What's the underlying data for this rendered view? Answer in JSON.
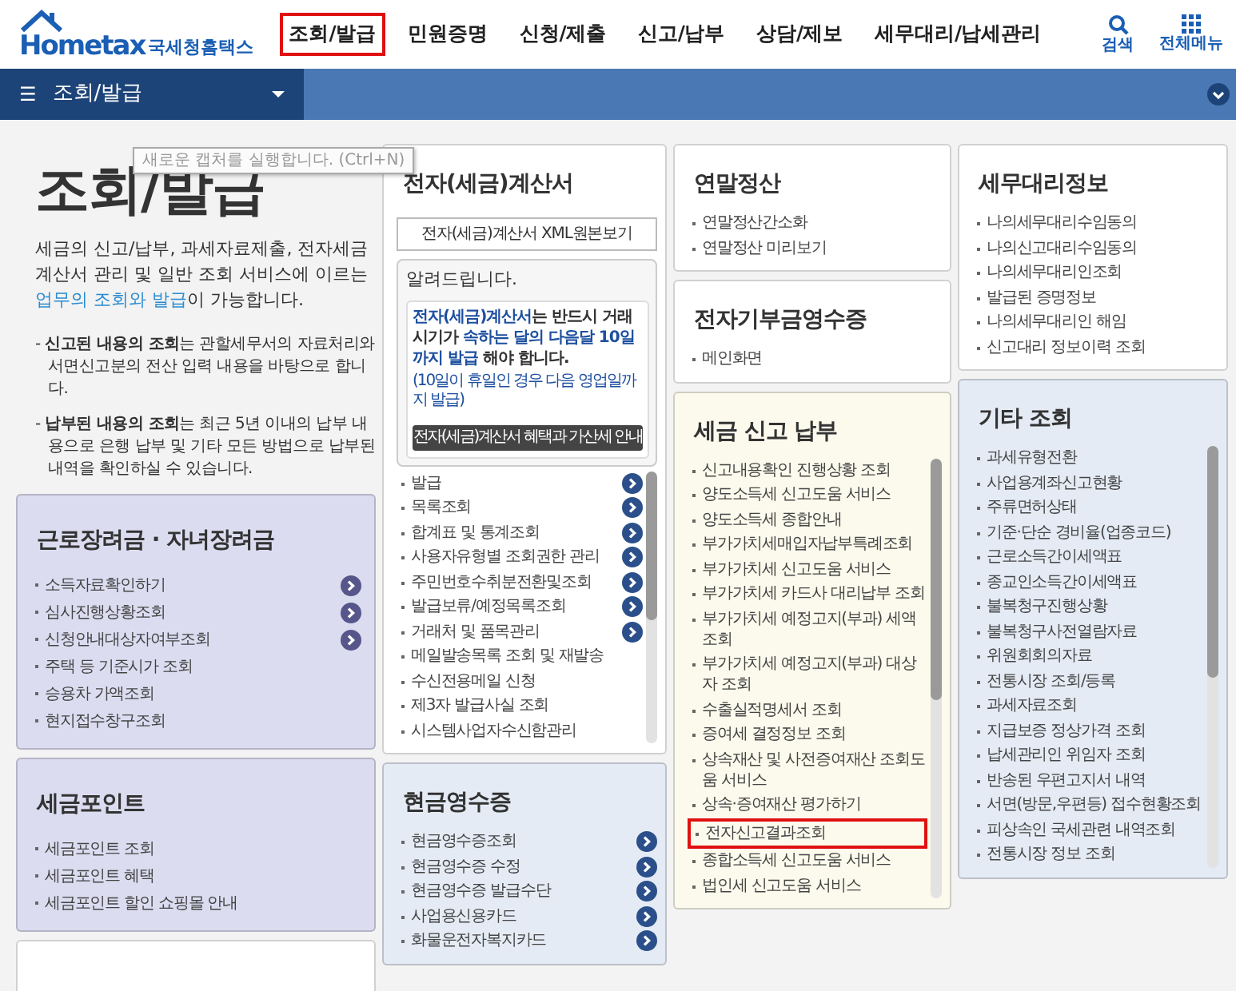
{
  "header": {
    "logo": {
      "brand": "Hometax",
      "subtitle": "국세청홈택스"
    },
    "nav": [
      {
        "label": "조회/발급",
        "highlighted": true
      },
      {
        "label": "민원증명",
        "highlighted": false
      },
      {
        "label": "신청/제출",
        "highlighted": false
      },
      {
        "label": "신고/납부",
        "highlighted": false
      },
      {
        "label": "상담/제보",
        "highlighted": false
      },
      {
        "label": "세무대리/납세관리",
        "highlighted": false
      }
    ],
    "tools": [
      {
        "kind": "search",
        "label": "검색"
      },
      {
        "kind": "menu",
        "label": "전체메뉴"
      }
    ]
  },
  "menu_bar": {
    "icon": "☰",
    "label": "조회/발급"
  },
  "tooltip": "새로운 캡처를 실행합니다. (Ctrl+N)",
  "intro": {
    "title": "조회/발급",
    "description": [
      {
        "text": "세금의 신고/납부, 과세자료제출, 전자세금계산서 관리 및 일반 조회 서비스에 이르는 ",
        "emphasis": false
      },
      {
        "text": "업무의 조회와 발급",
        "emphasis": true
      },
      {
        "text": "이 가능합니다.",
        "emphasis": false
      }
    ],
    "notes": [
      "- **신고된 내용의 조회**는 관할세무서의 자료처리와 서면신고분의 전산 입력 내용을 바탕으로 합니다.",
      "- **납부된 내용의 조회**는 최근 5년 이내의 납부 내용으로 은행 납부 및 기타 모든 방법으로 납부된 내역을 확인하실 수 있습니다."
    ]
  },
  "columns": [
    {
      "cards": [
        {
          "title": "근로장려금 · 자녀장려금",
          "color": "#dcdcf1",
          "items": [
            {
              "label": "소득자료확인하기",
              "arrow": true,
              "highlighted": false
            },
            {
              "label": "심사진행상황조회",
              "arrow": true,
              "highlighted": false
            },
            {
              "label": "신청안내대상자여부조회",
              "arrow": true,
              "highlighted": false
            },
            {
              "label": "주택 등 기준시가 조회",
              "arrow": false,
              "highlighted": false
            },
            {
              "label": "승용차 가액조회",
              "arrow": false,
              "highlighted": false
            },
            {
              "label": "현지접수창구조회",
              "arrow": false,
              "highlighted": false
            }
          ]
        },
        {
          "title": "세금포인트",
          "color": "#dcdcf1",
          "items": [
            {
              "label": "세금포인트 조회",
              "arrow": false,
              "highlighted": false
            },
            {
              "label": "세금포인트 혜택",
              "arrow": false,
              "highlighted": false
            },
            {
              "label": "세금포인트 할인 쇼핑몰 안내",
              "arrow": false,
              "highlighted": false
            }
          ]
        },
        {
          "color": "#ffffff"
        }
      ]
    },
    {
      "cards": [
        {
          "title": "전자(세금)계산서",
          "color": "#ffffff",
          "scrollable": true,
          "button": "전자(세금)계산서 XML원본보기",
          "notice": {
            "title": "알려드립니다.",
            "text": [
              {
                "text": "전자(세금)계산서",
                "emphasis": true
              },
              {
                "text": "는 반드시 거래시기가 ",
                "emphasis": false
              },
              {
                "text": "속하는 달의 다음달 10일까지 발급",
                "emphasis": true
              },
              {
                "text": " 해야 합니다.",
                "emphasis": false
              }
            ],
            "note": "(10일이 휴일인 경우 다음 영업일까지 발급)",
            "button": "전자(세금)계산서 혜택과 가산세 안내"
          },
          "items": [
            {
              "label": "발급",
              "arrow": true,
              "highlighted": false
            },
            {
              "label": "목록조회",
              "arrow": true,
              "highlighted": false
            },
            {
              "label": "합계표 및 통계조회",
              "arrow": true,
              "highlighted": false
            },
            {
              "label": "사용자유형별 조회권한 관리",
              "arrow": true,
              "highlighted": false
            },
            {
              "label": "주민번호수취분전환및조회",
              "arrow": true,
              "highlighted": false
            },
            {
              "label": "발급보류/예정목록조회",
              "arrow": true,
              "highlighted": false
            },
            {
              "label": "거래처 및 품목관리",
              "arrow": true,
              "highlighted": false
            },
            {
              "label": "메일발송목록 조회 및 재발송",
              "arrow": false,
              "highlighted": false
            },
            {
              "label": "수신전용메일 신청",
              "arrow": false,
              "highlighted": false
            },
            {
              "label": "제3자 발급사실 조회",
              "arrow": false,
              "highlighted": false
            },
            {
              "label": "시스템사업자수신함관리",
              "arrow": false,
              "highlighted": false
            }
          ]
        },
        {
          "title": "현금영수증",
          "color": "#e4ebf5",
          "items": [
            {
              "label": "현금영수증조회",
              "arrow": true,
              "highlighted": false
            },
            {
              "label": "현금영수증 수정",
              "arrow": true,
              "highlighted": false
            },
            {
              "label": "현금영수증 발급수단",
              "arrow": true,
              "highlighted": false
            },
            {
              "label": "사업용신용카드",
              "arrow": true,
              "highlighted": false
            },
            {
              "label": "화물운전자복지카드",
              "arrow": true,
              "highlighted": false
            }
          ]
        }
      ]
    },
    {
      "cards": [
        {
          "title": "연말정산",
          "color": "#ffffff",
          "items": [
            {
              "label": "연말정산간소화",
              "arrow": false,
              "highlighted": false
            },
            {
              "label": "연말정산 미리보기",
              "arrow": false,
              "highlighted": false
            }
          ]
        },
        {
          "title": "전자기부금영수증",
          "color": "#ffffff",
          "items": [
            {
              "label": "메인화면",
              "arrow": false,
              "highlighted": false
            }
          ]
        },
        {
          "title": "세금 신고 납부",
          "color": "#fbfaec",
          "scrollable": true,
          "items": [
            {
              "label": "신고내용확인 진행상황 조회",
              "arrow": false,
              "highlighted": false
            },
            {
              "label": "양도소득세 신고도움 서비스",
              "arrow": false,
              "highlighted": false
            },
            {
              "label": "양도소득세 종합안내",
              "arrow": false,
              "highlighted": false
            },
            {
              "label": "부가가치세매입자납부특례조회",
              "arrow": false,
              "highlighted": false
            },
            {
              "label": "부가가치세 신고도움 서비스",
              "arrow": false,
              "highlighted": false
            },
            {
              "label": "부가가치세 카드사 대리납부 조회",
              "arrow": false,
              "highlighted": false
            },
            {
              "label": "부가가치세 예정고지(부과) 세액조회",
              "arrow": false,
              "highlighted": false
            },
            {
              "label": "부가가치세 예정고지(부과) 대상자 조회",
              "arrow": false,
              "highlighted": false
            },
            {
              "label": "수출실적명세서 조회",
              "arrow": false,
              "highlighted": false
            },
            {
              "label": "증여세 결정정보 조회",
              "arrow": false,
              "highlighted": false
            },
            {
              "label": "상속재산 및 사전증여재산 조회도움 서비스",
              "arrow": false,
              "highlighted": false
            },
            {
              "label": "상속·증여재산 평가하기",
              "arrow": false,
              "highlighted": false
            },
            {
              "label": "전자신고결과조회",
              "arrow": false,
              "highlighted": true
            },
            {
              "label": "종합소득세 신고도움 서비스",
              "arrow": false,
              "highlighted": false
            },
            {
              "label": "법인세 신고도움 서비스",
              "arrow": false,
              "highlighted": false
            }
          ]
        }
      ]
    },
    {
      "cards": [
        {
          "title": "세무대리정보",
          "color": "#ffffff",
          "items": [
            {
              "label": "나의세무대리수임동의",
              "arrow": false,
              "highlighted": false
            },
            {
              "label": "나의신고대리수임동의",
              "arrow": false,
              "highlighted": false
            },
            {
              "label": "나의세무대리인조회",
              "arrow": false,
              "highlighted": false
            },
            {
              "label": "발급된 증명정보",
              "arrow": false,
              "highlighted": false
            },
            {
              "label": "나의세무대리인 해임",
              "arrow": false,
              "highlighted": false
            },
            {
              "label": "신고대리 정보이력 조회",
              "arrow": false,
              "highlighted": false
            }
          ]
        },
        {
          "title": "기타 조회",
          "color": "#e4ebf5",
          "scrollable": true,
          "items": [
            {
              "label": "과세유형전환",
              "arrow": false,
              "highlighted": false
            },
            {
              "label": "사업용계좌신고현황",
              "arrow": false,
              "highlighted": false
            },
            {
              "label": "주류면허상태",
              "arrow": false,
              "highlighted": false
            },
            {
              "label": "기준·단순 경비율(업종코드)",
              "arrow": false,
              "highlighted": false
            },
            {
              "label": "근로소득간이세액표",
              "arrow": false,
              "highlighted": false
            },
            {
              "label": "종교인소득간이세액표",
              "arrow": false,
              "highlighted": false
            },
            {
              "label": "불복청구진행상황",
              "arrow": false,
              "highlighted": false
            },
            {
              "label": "불복청구사전열람자료",
              "arrow": false,
              "highlighted": false
            },
            {
              "label": "위원회회의자료",
              "arrow": false,
              "highlighted": false
            },
            {
              "label": "전통시장 조회/등록",
              "arrow": false,
              "highlighted": false
            },
            {
              "label": "과세자료조회",
              "arrow": false,
              "highlighted": false
            },
            {
              "label": "지급보증 정상가격 조회",
              "arrow": false,
              "highlighted": false
            },
            {
              "label": "납세관리인 위임자 조회",
              "arrow": false,
              "highlighted": false
            },
            {
              "label": "반송된 우편고지서 내역",
              "arrow": false,
              "highlighted": false
            },
            {
              "label": "서면(방문,우편등) 접수현황조회",
              "arrow": false,
              "highlighted": false
            },
            {
              "label": "피상속인 국세관련 내역조회",
              "arrow": false,
              "highlighted": false
            },
            {
              "label": "전통시장 정보 조회",
              "arrow": false,
              "highlighted": false
            }
          ]
        }
      ]
    }
  ]
}
